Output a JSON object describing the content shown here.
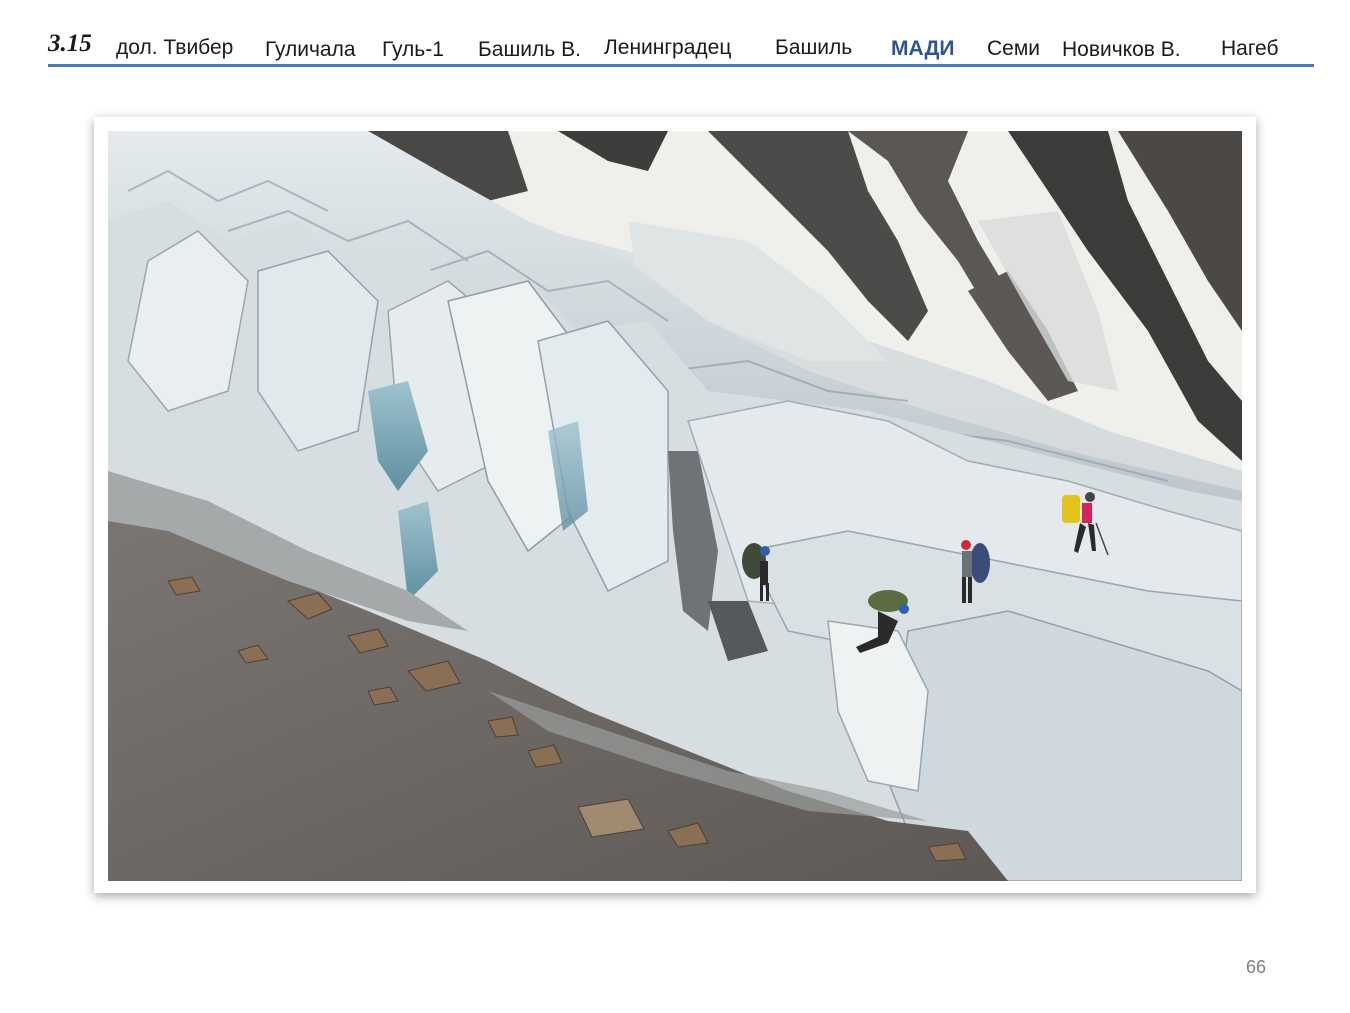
{
  "header": {
    "section_number": "3.15",
    "nav": [
      {
        "label": "дол. Твибер",
        "active": false
      },
      {
        "label": "Гуличала",
        "active": false
      },
      {
        "label": "Гуль-1",
        "active": false
      },
      {
        "label": "Башиль В.",
        "active": false
      },
      {
        "label": "Ленинградец",
        "active": false
      },
      {
        "label": "Башиль",
        "active": false
      },
      {
        "label": "МАДИ",
        "active": true
      },
      {
        "label": "Семи",
        "active": false
      },
      {
        "label": "Новичков В.",
        "active": false
      },
      {
        "label": "Нагеб",
        "active": false
      }
    ],
    "accent_color": "#2f5496",
    "rule_color": "#4a7ab5"
  },
  "photo": {
    "subject": "glacier-icefall-with-climbers",
    "climber_count": 4
  },
  "page_number": "66"
}
